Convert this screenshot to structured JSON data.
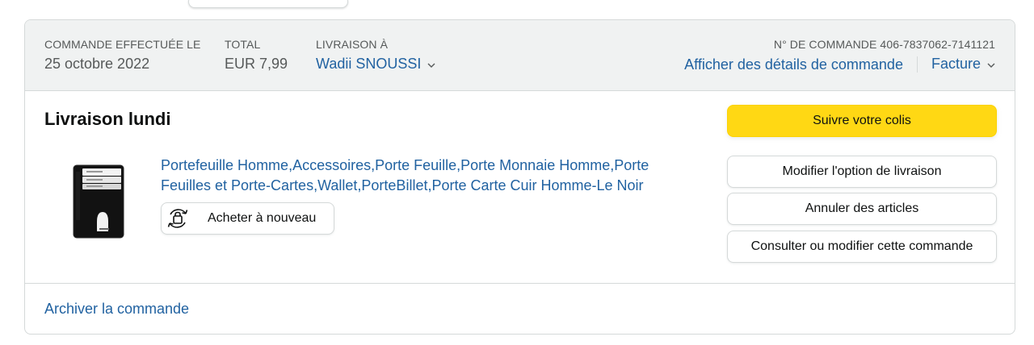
{
  "header": {
    "order_placed_label": "COMMANDE EFFECTUÉE LE",
    "order_date": "25 octobre 2022",
    "total_label": "TOTAL",
    "total_value": "EUR 7,99",
    "ship_to_label": "LIVRAISON À",
    "ship_to_name": "Wadii SNOUSSI",
    "order_number_label": "N° DE COMMANDE 406-7837062-7141121",
    "details_link": "Afficher des détails de commande",
    "invoice_link": "Facture"
  },
  "delivery": {
    "title": "Livraison lundi"
  },
  "product": {
    "title": "Portefeuille Homme,Accessoires,Porte Feuille,Porte Monnaie Homme,Porte Feuilles et Porte-Cartes,Wallet,PorteBillet,Porte Carte Cuir Homme-Le Noir",
    "buy_again_label": "Acheter à nouveau"
  },
  "actions": {
    "track_package": "Suivre votre colis",
    "change_delivery": "Modifier l'option de livraison",
    "cancel_items": "Annuler des articles",
    "view_edit_order": "Consulter ou modifier cette commande"
  },
  "footer": {
    "archive_link": "Archiver la commande"
  },
  "icons": {
    "chevron": "chevron-down-icon",
    "buy_again": "reorder-bag-icon"
  },
  "colors": {
    "link": "#2162a1",
    "primary_button": "#ffd814",
    "header_bg": "#f0f2f2",
    "border": "#d5d9d9"
  }
}
